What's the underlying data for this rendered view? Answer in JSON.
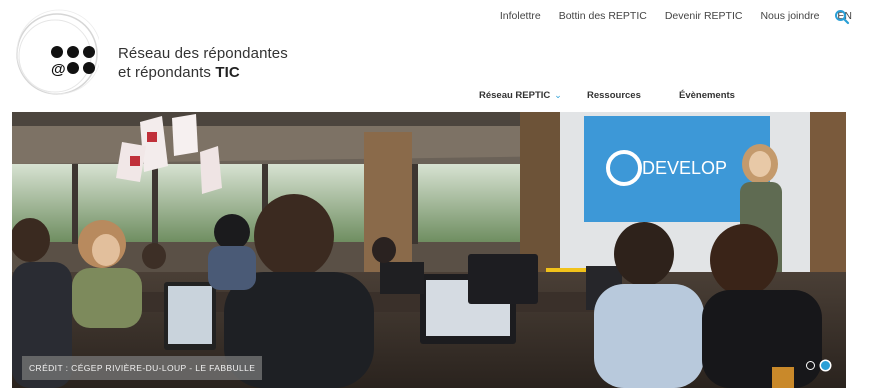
{
  "logo": {
    "line1": "Réseau des répondantes",
    "line2_prefix": "et répondants ",
    "line2_bold": "TIC",
    "mark_symbol": "@"
  },
  "top_nav": {
    "items": [
      {
        "label": "Infolettre"
      },
      {
        "label": "Bottin des REPTIC"
      },
      {
        "label": "Devenir REPTIC"
      },
      {
        "label": "Nous joindre"
      },
      {
        "label": "EN"
      }
    ],
    "search_icon": "search-icon"
  },
  "main_nav": {
    "items": [
      {
        "label": "Réseau REPTIC",
        "has_dropdown": true
      },
      {
        "label": "Ressources",
        "has_dropdown": false
      },
      {
        "label": "Évènements",
        "has_dropdown": false
      }
    ]
  },
  "hero": {
    "screen_text": "DEVELOP",
    "credit": "CRÉDIT : CÉGEP RIVIÈRE-DU-LOUP - LE FABBULLE",
    "slides": 2,
    "active_slide": 2
  },
  "colors": {
    "accent": "#2a9fd6",
    "text": "#333333"
  }
}
